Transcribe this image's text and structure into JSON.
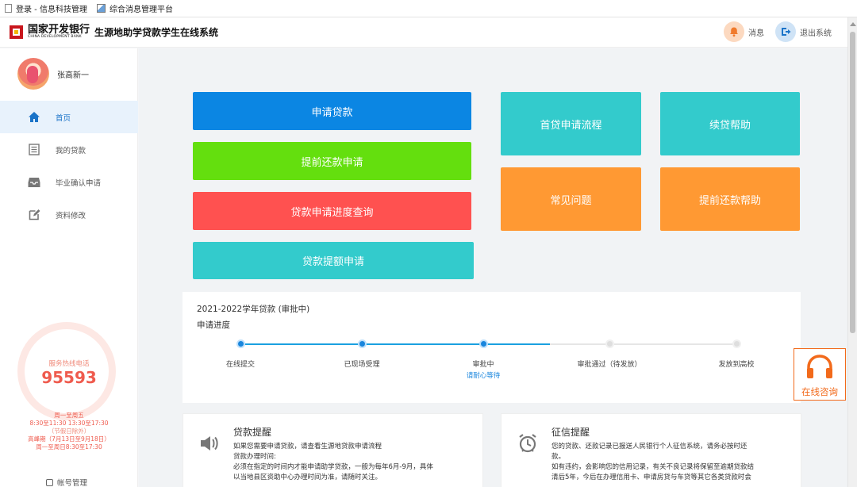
{
  "browser": {
    "bookmarks": [
      "登录 - 信息科技管理",
      "综合消息管理平台"
    ]
  },
  "header": {
    "logo_cn": "国家开发银行",
    "logo_en": "CHINA DEVELOPMENT BANK",
    "system_title": "生源地助学贷款学生在线系统",
    "messages_label": "消息",
    "logout_label": "退出系统"
  },
  "sidebar": {
    "user_name": "张高新一",
    "items": [
      {
        "label": "首页",
        "icon": "home-icon",
        "active": true
      },
      {
        "label": "我的贷款",
        "icon": "document-list-icon"
      },
      {
        "label": "毕业确认申请",
        "icon": "inbox-icon"
      },
      {
        "label": "资料修改",
        "icon": "edit-icon"
      }
    ],
    "hotline_label": "服务热线电话",
    "hotline_number": "95593",
    "hours": [
      "周一至周五",
      "8:30至11:30 13:30至17:30",
      "（节假日除外）",
      "高峰期（7月13日至9月18日）",
      "周一至周日8:30至17:30"
    ],
    "account_label": "帐号管理"
  },
  "tiles": {
    "apply_loan": "申请贷款",
    "early_repay_apply": "提前还款申请",
    "progress_query": "贷款申请进度查询",
    "increase_apply": "贷款提额申请",
    "first_loan_process": "首贷申请流程",
    "renew_help": "续贷帮助",
    "faq": "常见问题",
    "early_repay_help": "提前还款帮助"
  },
  "progress": {
    "title": "2021-2022学年贷款 (审批中)",
    "subtitle": "申请进度",
    "steps": [
      {
        "label": "在线提交",
        "done": true,
        "note": ""
      },
      {
        "label": "已现场受理",
        "done": true,
        "note": ""
      },
      {
        "label": "审批中",
        "done": true,
        "note": "请耐心等待"
      },
      {
        "label": "审批通过（待发放）",
        "done": false,
        "note": ""
      },
      {
        "label": "发放到高校",
        "done": false,
        "note": ""
      }
    ]
  },
  "notices": {
    "loan": {
      "title": "贷款提醒",
      "lines": [
        "如果您需要申请贷款，请查看生源地贷款申请流程",
        "贷款办理时间:",
        "必须在指定的时间内才能申请助学贷款，一般为每年6月-9月，具体",
        "以当地县区资助中心办理时间为准，请随时关注。"
      ]
    },
    "credit": {
      "title": "征信提醒",
      "lines": [
        "您的贷款、还款记录已报送人民银行个人征信系统，请务必按时还",
        "款。",
        "如有违约，会影响您的信用记录，有关不良记录将保留至逾期贷款结",
        "清后5年，今后在办理信用卡、申请房贷与车贷等其它各类贷款时会"
      ]
    }
  },
  "consult": {
    "label": "在线咨询"
  },
  "colors": {
    "blue": "#0b86e3",
    "green": "#64df0e",
    "red": "#ff5150",
    "teal": "#33cbcc",
    "orange": "#ff9933",
    "accent": "#1a86dd"
  }
}
